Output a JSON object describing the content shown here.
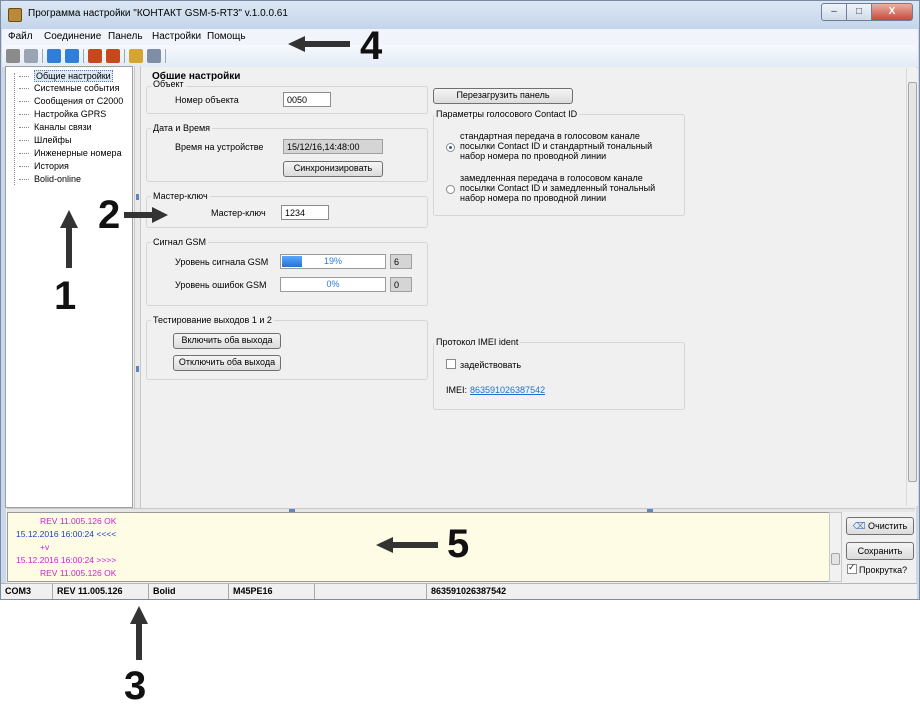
{
  "window": {
    "title": "Программа настройки \"КОНТАКТ GSM-5-RT3\" v.1.0.0.61",
    "controls": {
      "minimize": "–",
      "maximize": "□",
      "close": "X"
    }
  },
  "menu": [
    "Файл",
    "Соединение",
    "Панель",
    "Настройки",
    "Помощь"
  ],
  "toolbar_icons": [
    "connect-icon",
    "disconnect-icon",
    "read-icon",
    "write-icon",
    "upload-icon",
    "download-icon",
    "notes-icon",
    "print-icon"
  ],
  "tree": {
    "items": [
      "Общие настройки",
      "Системные события",
      "Сообщения от С2000",
      "Настройка GPRS",
      "Каналы связи",
      "Шлейфы",
      "Инженерные номера",
      "История",
      "Bolid-online"
    ],
    "selected": 0
  },
  "panel": {
    "title": "Общие настройки",
    "object": {
      "group": "Объект",
      "label": "Номер объекта",
      "value": "0050"
    },
    "datetime": {
      "group": "Дата и Время",
      "label": "Время на устройстве",
      "value": "15/12/16,14:48:00",
      "sync_button": "Синхронизировать"
    },
    "master_key": {
      "group": "Мастер-ключ",
      "label": "Мастер-ключ",
      "value": "1234"
    },
    "gsm": {
      "group": "Сигнал GSM",
      "signal_label": "Уровень сигнала GSM",
      "signal_percent": "19%",
      "signal_value": "6",
      "signal_fraction": 0.19,
      "error_label": "Уровень ошибок GSM",
      "error_percent": "0%",
      "error_value": "0",
      "error_fraction": 0
    },
    "outputs": {
      "group": "Тестирование выходов 1 и 2",
      "on_button": "Включить оба выхода",
      "off_button": "Отключить оба выхода"
    },
    "reboot_button": "Перезагрузить панель",
    "contact_id": {
      "group": "Параметры голосового Contact ID",
      "option1": [
        "стандартная передача в голосовом канале",
        "посылки Contact ID и стандартный тональный",
        "набор номера по проводной линии"
      ],
      "option2": [
        "замедленная передача в голосовом канале",
        "посылки Contact ID и замедленный тональный",
        "набор номера по проводной линии"
      ],
      "selected": 1
    },
    "imei": {
      "group": "Протокол IMEI ident",
      "checkbox_label": "задействовать",
      "checked": false,
      "label": "IMEI:",
      "value": "863591026387542"
    }
  },
  "log": {
    "lines": [
      {
        "text": "REV 11.005.126  OK",
        "color": "#d020d0",
        "indent": true
      },
      {
        "text": "15.12.2016 16:00:24 <<<<",
        "color": "#1a3ad0",
        "indent": false
      },
      {
        "text": "+v",
        "color": "#d020d0",
        "indent": true
      },
      {
        "text": "15.12.2016 16:00:24 >>>>",
        "color": "#d020d0",
        "indent": false
      },
      {
        "text": "REV 11.005.126  OK",
        "color": "#d020d0",
        "indent": true
      }
    ],
    "clear_button": "Очистить",
    "save_button": "Сохранить",
    "scroll_label": "Прокрутка?",
    "scroll_checked": true
  },
  "status": [
    "COM3",
    "REV 11.005.126",
    "Bolid",
    "M45PE16",
    "",
    "863591026387542"
  ],
  "callouts": [
    "1",
    "2",
    "3",
    "4",
    "5"
  ]
}
